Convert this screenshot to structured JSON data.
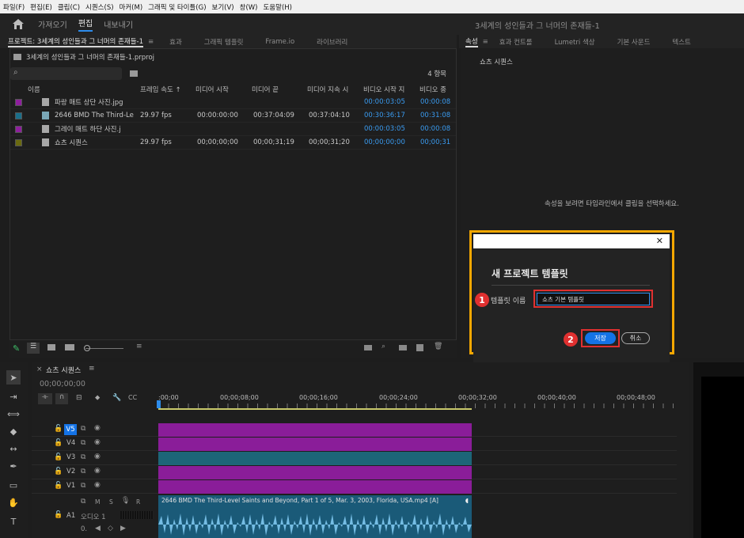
{
  "menu": [
    "파일(F)",
    "편집(E)",
    "클립(C)",
    "시퀀스(S)",
    "마커(M)",
    "그래픽 및 타이틀(G)",
    "보기(V)",
    "창(W)",
    "도움말(H)"
  ],
  "workspaces": {
    "import": "가져오기",
    "edit": "편집",
    "export": "내보내기"
  },
  "doc_title": "3세계의 성인들과 그 너머의 존재들-1",
  "project_tabs": [
    "프로젝트: 3세계의 성인들과 그 너머의 존재들-1",
    "효과",
    "그래픽 템플릿",
    "Frame.io",
    "라이브러리"
  ],
  "project": {
    "file": "3세계의 성인들과 그 너머의 존재들-1.prproj",
    "item_count": "4 항목",
    "search_placeholder": "",
    "columns": [
      "이름",
      "프레임 속도 ↑",
      "미디어 시작",
      "미디어 끝",
      "미디어 지속 시",
      "비디오 시작 지",
      "비디오 종"
    ],
    "rows": [
      {
        "color": "#8f1f9e",
        "icon": "image-icon",
        "name": "파랑 매트 상단 사진.jpg",
        "fps": "",
        "mstart": "",
        "mend": "",
        "mdur": "",
        "vstart": "00:00:03:05",
        "vend": "00:00:08"
      },
      {
        "color": "#1a6f8a",
        "icon": "video-file-icon",
        "name": "2646 BMD The Third-Le",
        "fps": "29.97 fps",
        "mstart": "00:00:00:00",
        "mend": "00:37:04:09",
        "mdur": "00:37:04:10",
        "vstart": "00:30:36:17",
        "vend": "00:31:08"
      },
      {
        "color": "#8f1f9e",
        "icon": "image-icon",
        "name": "그레이 매트 하단 사진.j",
        "fps": "",
        "mstart": "",
        "mend": "",
        "mdur": "",
        "vstart": "00:00:03:05",
        "vend": "00:00:08"
      },
      {
        "color": "#6a6a10",
        "icon": "sequence-icon",
        "name": "쇼츠 시퀀스",
        "fps": "29.97 fps",
        "mstart": "00;00;00;00",
        "mend": "00;00;31;19",
        "mdur": "00;00;31;20",
        "vstart": "00;00;00;00",
        "vend": "00;00;31"
      }
    ]
  },
  "right_tabs": [
    "속성",
    "효과 컨트롤",
    "Lumetri 색상",
    "기본 사운드",
    "텍스트"
  ],
  "properties": {
    "title": "쇼츠 시퀀스",
    "hint": "속성을 보려면 타임라인에서 클립을 선택하세요."
  },
  "dialog": {
    "title": "새 프로젝트 템플릿",
    "label": "템플릿 이름",
    "value": "쇼츠 기본 템플릿",
    "save": "저장",
    "cancel": "취소",
    "badge1": "1",
    "badge2": "2",
    "highlight": "#f5a700",
    "badge_color": "#e03030"
  },
  "timeline": {
    "tab": "쇼츠 시퀀스",
    "timecode": "00;00;00;00",
    "ruler": [
      ":00;00",
      "00;00;08;00",
      "00;00;16;00",
      "00;00;24;00",
      "00;00;32;00",
      "00;00;40;00",
      "00;00;48;00"
    ],
    "tracks": [
      "V5",
      "V4",
      "V3",
      "V2",
      "V1"
    ],
    "audio_track": "A1",
    "audio_name": "오디오 1",
    "audio_level": "0.",
    "audio_buttons": [
      "M",
      "S",
      "R"
    ],
    "clip_name": "2646 BMD The Third-Level Saints and Beyond, Part 1 of 5, Mar. 3, 2003, Florida, USA.mp4 [A]"
  }
}
